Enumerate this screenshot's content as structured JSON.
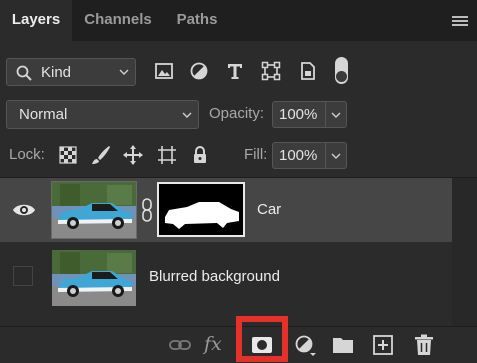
{
  "tabs": [
    {
      "label": "Layers",
      "active": true
    },
    {
      "label": "Channels",
      "active": false
    },
    {
      "label": "Paths",
      "active": false
    }
  ],
  "filter": {
    "kind_label": "Kind",
    "icons": [
      "image-filter-icon",
      "adjustment-filter-icon",
      "type-filter-icon",
      "shape-filter-icon",
      "smart-object-filter-icon",
      "filter-toggle"
    ]
  },
  "blend": {
    "mode": "Normal",
    "opacity_label": "Opacity:",
    "opacity_value": "100%"
  },
  "lock": {
    "label": "Lock:",
    "fill_label": "Fill:",
    "fill_value": "100%",
    "icons": [
      "lock-transparent-pixels-icon",
      "lock-image-pixels-icon",
      "lock-position-icon",
      "lock-artboard-icon",
      "lock-all-icon"
    ]
  },
  "layers": [
    {
      "name": "Car",
      "visible": true,
      "selected": true,
      "has_mask": true
    },
    {
      "name": "Blurred background",
      "visible": false,
      "selected": false,
      "has_mask": false
    }
  ],
  "bottom_bar": {
    "icons": [
      "link-layers-icon",
      "fx-icon",
      "add-mask-icon",
      "adjustment-layer-icon",
      "new-group-icon",
      "new-layer-icon",
      "delete-icon"
    ],
    "fx_text": "fx",
    "highlighted": "add-mask-icon"
  },
  "colors": {
    "panel_bg": "#2b2b2b",
    "selected_row": "#464646",
    "highlight": "#e4322b"
  }
}
